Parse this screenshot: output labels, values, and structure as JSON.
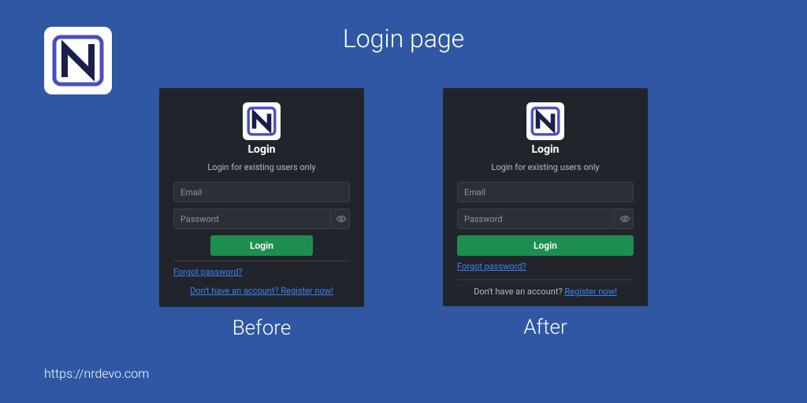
{
  "page": {
    "title": "Login page",
    "site_url": "https://nrdevo.com"
  },
  "captions": {
    "before": "Before",
    "after": "After"
  },
  "login": {
    "heading": "Login",
    "subheading": "Login for existing users only",
    "email_placeholder": "Email",
    "password_placeholder": "Password",
    "login_button": "Login",
    "forgot_password": "Forgot password?",
    "register_prompt": "Don't have an account?",
    "register_cta": "Register now!",
    "register_full": "Don't have an account? Register now!"
  },
  "colors": {
    "page_bg": "#2f57a4",
    "card_bg": "#21252b",
    "input_bg": "#2b3038",
    "button_bg": "#1e8e50",
    "link": "#3b82f6",
    "logo_accent": "#4a4fbf"
  }
}
